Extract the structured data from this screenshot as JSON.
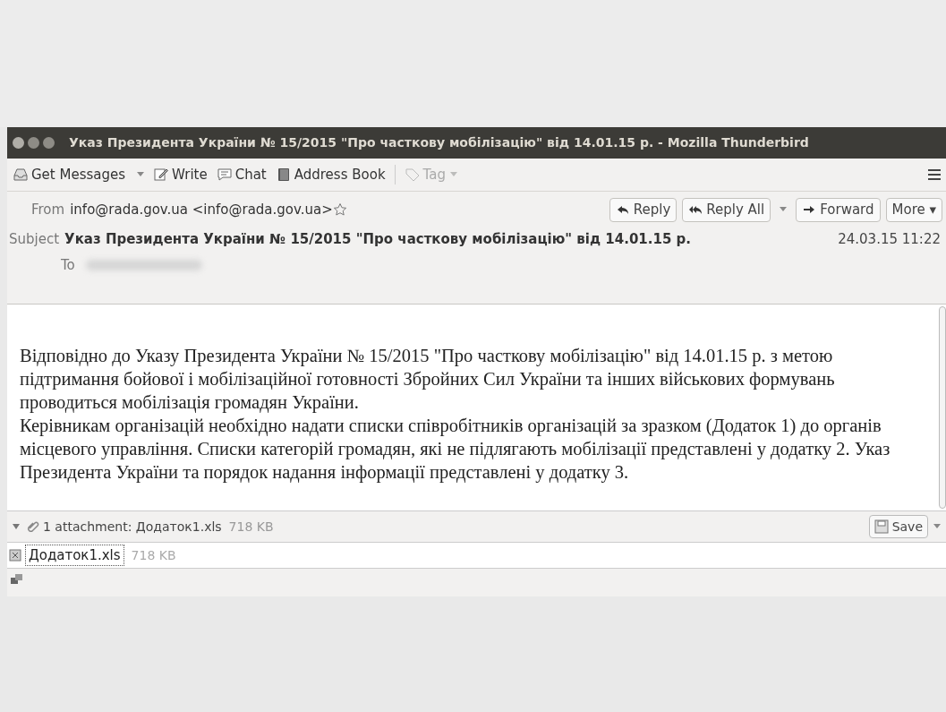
{
  "window": {
    "title": "Указ Президента України № 15/2015 \"Про часткову мобілізацію\" від 14.01.15 р. - Mozilla Thunderbird"
  },
  "toolbar": {
    "items": [
      {
        "kind": "dropdown",
        "label": "Get Messages",
        "disabled": false
      },
      {
        "kind": "button",
        "label": "Write",
        "disabled": false
      },
      {
        "kind": "button",
        "label": "Chat",
        "disabled": false
      },
      {
        "kind": "button",
        "label": "Address Book",
        "disabled": false
      },
      {
        "kind": "dropdown",
        "label": "Tag",
        "disabled": true
      }
    ]
  },
  "header": {
    "from_label": "From",
    "from": "info@rada.gov.ua <info@rada.gov.ua>",
    "actions": [
      {
        "label": "Reply",
        "menu": false
      },
      {
        "label": "Reply All",
        "menu": true
      },
      {
        "label": "Forward",
        "menu": false
      },
      {
        "label": "More ▾",
        "menu": false
      }
    ],
    "subject_label": "Subject",
    "subject": "Указ Президента України № 15/2015 \"Про часткову мобілізацію\" від 14.01.15 р.",
    "date": "24.03.15 11:22",
    "to_label": "To"
  },
  "body": {
    "paragraphs": [
      "Відповідно до Указу Президента України № 15/2015 \"Про часткову мобілізацію\" від 14.01.15 р. з метою підтримання бойової і мобілізаційної готовності Збройних Сил України та інших військових формувань проводиться мобілізація громадян України.",
      "Керівникам організацій необхідно надати списки співробітників організацій за зразком (Додаток 1) до органів місцевого управління. Списки категорій громадян, які не підлягають мобілізації представлені у додатку 2. Указ Президента України та порядок надання інформації представлені у додатку 3."
    ]
  },
  "attachments": {
    "expanded": true,
    "summary": "1 attachment: Додаток1.xls",
    "summary_size": "718 KB",
    "save_label": "Save",
    "files": [
      {
        "name": "Додаток1.xls",
        "size": "718 KB",
        "selected": true
      }
    ]
  }
}
